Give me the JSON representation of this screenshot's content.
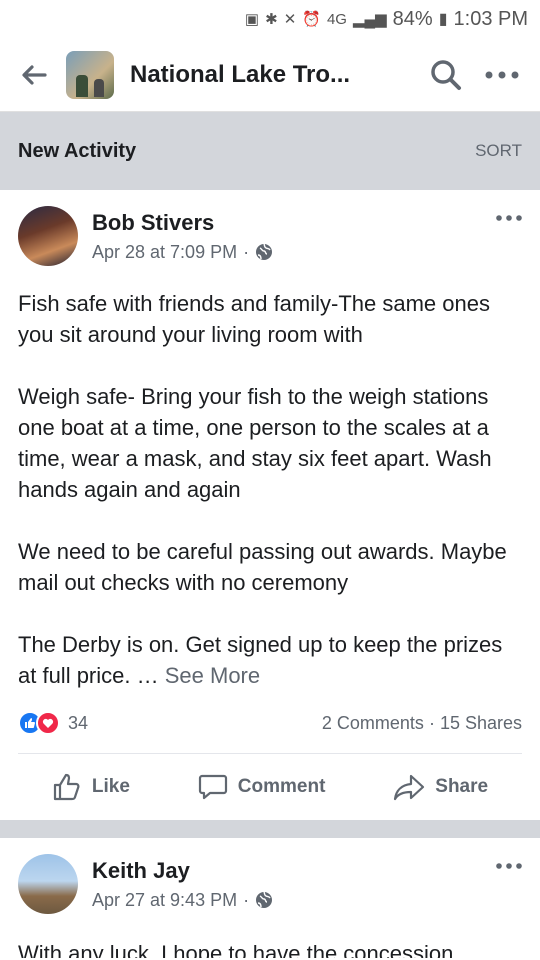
{
  "status_bar": {
    "network": "4G",
    "battery": "84%",
    "time": "1:03 PM"
  },
  "app_bar": {
    "title": "National Lake Tro..."
  },
  "section": {
    "title": "New Activity",
    "sort_label": "SORT"
  },
  "posts": [
    {
      "author": "Bob Stivers",
      "timestamp": "Apr 28 at 7:09 PM",
      "paragraphs": [
        "Fish safe with friends and family-The same ones you sit around your living room with",
        "Weigh safe- Bring your fish to the weigh stations one boat at a time, one person to the scales at a time, wear a mask,  and stay six feet apart.   Wash hands again and again",
        "We need to be careful passing out awards. Maybe mail out checks with no ceremony",
        "The Derby is on.  Get signed up to keep the prizes at full price. …"
      ],
      "see_more": "See More",
      "reaction_count": "34",
      "comments": "2 Comments",
      "shares": "15 Shares"
    },
    {
      "author": "Keith Jay",
      "timestamp": "Apr 27 at 9:43 PM",
      "preview": "With any luck, I hope to have the concession"
    }
  ],
  "actions": {
    "like": "Like",
    "comment": "Comment",
    "share": "Share"
  }
}
